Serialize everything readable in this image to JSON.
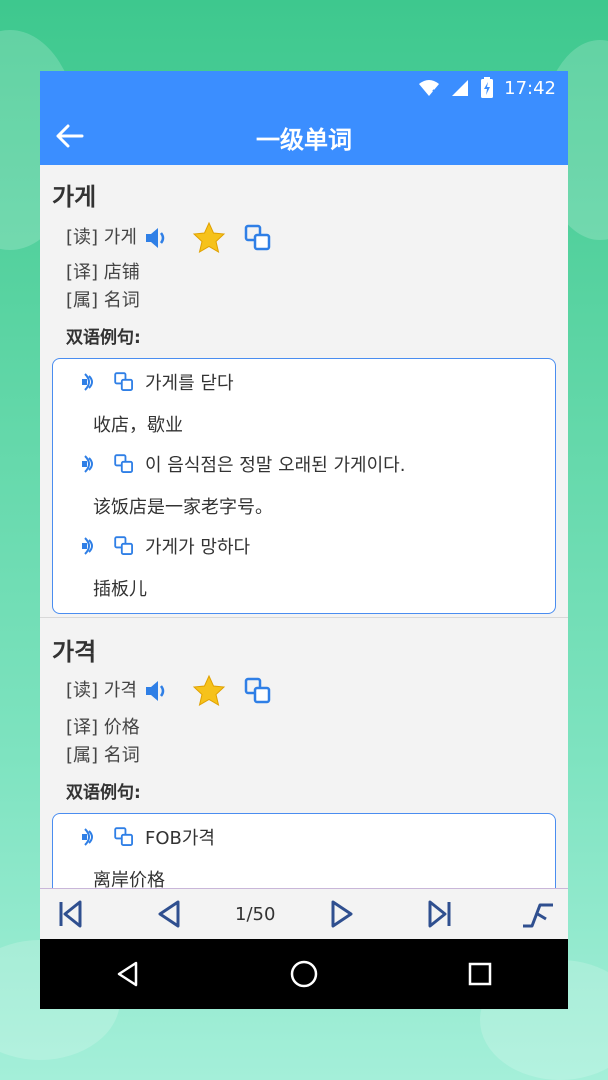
{
  "status": {
    "time": "17:42"
  },
  "app": {
    "title": "一级单词"
  },
  "entries": [
    {
      "word": "가게",
      "read_prefix": "[读]",
      "read": "가게",
      "trans_prefix": "[译]",
      "trans": "店铺",
      "pos_prefix": "[属]",
      "pos": "名词",
      "examples_label": "双语例句:",
      "examples": [
        {
          "kr": "가게를 닫다",
          "cn": "收店，歇业"
        },
        {
          "kr": "이 음식점은 정말 오래된 가게이다.",
          "cn": "该饭店是一家老字号。"
        },
        {
          "kr": "가게가 망하다",
          "cn": "插板儿"
        }
      ]
    },
    {
      "word": "가격",
      "read_prefix": "[读]",
      "read": "가격",
      "trans_prefix": "[译]",
      "trans": "价格",
      "pos_prefix": "[属]",
      "pos": "名词",
      "examples_label": "双语例句:",
      "examples": [
        {
          "kr": "FOB가격",
          "cn": "离岸价格"
        }
      ]
    }
  ],
  "nav": {
    "page": "1/50"
  },
  "colors": {
    "accent": "#3b8eff",
    "star": "#f6c21b",
    "box_border": "#4a8df0"
  }
}
